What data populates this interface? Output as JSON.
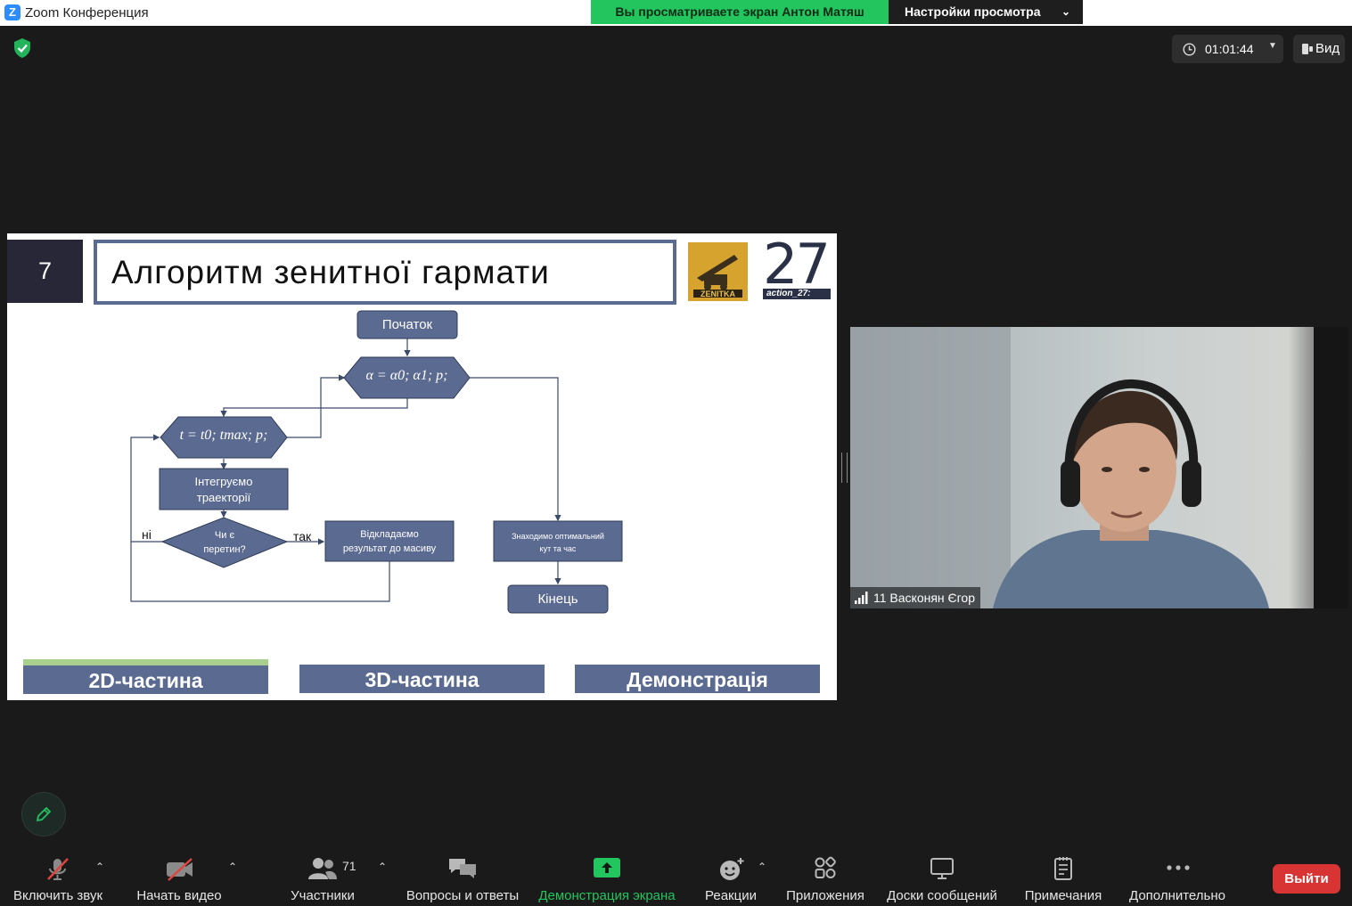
{
  "window": {
    "title": "Zoom Конференция",
    "logo_letter": "Z"
  },
  "share_banner": {
    "viewing_text": "Вы просматриваете экран Антон Матяш",
    "view_settings_label": "Настройки просмотра"
  },
  "meeting": {
    "elapsed_time": "01:01:44",
    "view_label": "Вид"
  },
  "slide": {
    "number": "7",
    "title": "Алгоритм зенитної гармати",
    "zenitka_logo_text": "ZENITKA",
    "logo27_text": "27",
    "logo27_sub": "action_27:",
    "flowchart": {
      "start": "Початок",
      "alpha_loop": "α = α0; α1; p;",
      "t_loop": "t = t0; tmax; p;",
      "integrate": [
        "Інтегруємо",
        "траекторії"
      ],
      "decision": [
        "Чи є",
        "перетин?"
      ],
      "no_label": "ні",
      "yes_label": "так",
      "store": [
        "Відкладаємо",
        "результат до масиву"
      ],
      "find": [
        "Знаходимо оптимальний",
        "кут та час"
      ],
      "end": "Кінець"
    },
    "tabs": [
      "2D-частина",
      "3D-частина",
      "Демонстрація"
    ],
    "active_tab_accent": "#a8cf8e"
  },
  "video": {
    "signal_strength": "4 of 4 bars",
    "participant_name": "11 Васконян Єгор"
  },
  "toolbar": {
    "unmute_label": "Включить звук",
    "start_video_label": "Начать видео",
    "participants_label": "Участники",
    "participants_count": "71",
    "qa_label": "Вопросы и ответы",
    "share_label": "Демонстрация экрана",
    "reactions_label": "Реакции",
    "apps_label": "Приложения",
    "whiteboards_label": "Доски сообщений",
    "notes_label": "Примечания",
    "more_label": "Дополнительно",
    "leave_label": "Выйти"
  },
  "colors": {
    "accent_green": "#22c55e",
    "slide_blue": "#5a6a91",
    "leave_red": "#d93434"
  }
}
